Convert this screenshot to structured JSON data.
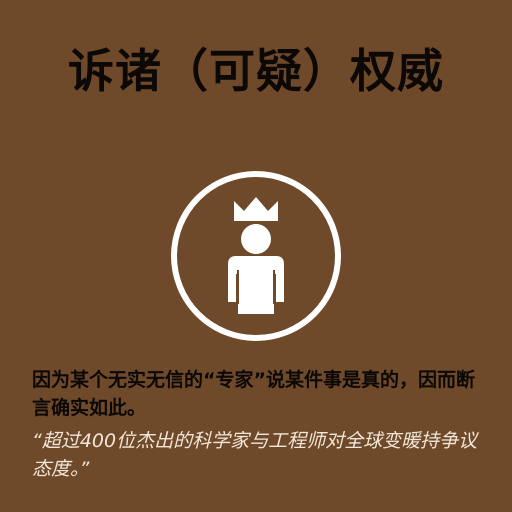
{
  "title": "诉诸（可疑）权威",
  "icon": "crowned-person-icon",
  "definition": "因为某个无实无信的“专家”说某件事是真的，因而断言确实如此。",
  "example": "“超过400位杰出的科学家与工程师对全球变暖持争议态度。”",
  "colors": {
    "background": "#6f4a2a",
    "title_text": "#0b0806",
    "icon": "#ffffff",
    "example_text": "#f1e6d8"
  }
}
